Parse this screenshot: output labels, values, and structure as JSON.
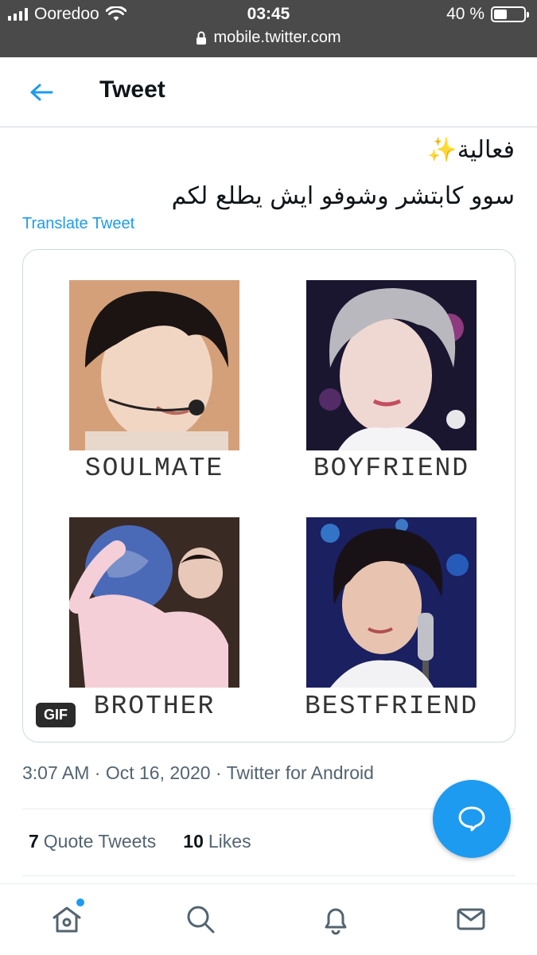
{
  "status_bar": {
    "carrier": "Ooredoo",
    "time": "03:45",
    "battery": "40 %",
    "url": "mobile.twitter.com"
  },
  "header": {
    "title": "Tweet",
    "back_icon": "arrow-left-icon"
  },
  "tweet": {
    "text_line1": "فعالية✨",
    "text_line2": "سوو كابتشر وشوفو ايش يطلع لكم",
    "translate_label": "Translate Tweet",
    "media": {
      "captions": [
        "SOULMATE",
        "BOYFRIEND",
        "BROTHER",
        "BESTFRIEND"
      ],
      "badge": "GIF"
    },
    "meta": {
      "time": "3:07 AM",
      "separator": "·",
      "date": "Oct 16, 2020",
      "source": "Twitter for Android"
    },
    "stats": {
      "quote_count": "7",
      "quote_label": "Quote Tweets",
      "like_count": "10",
      "like_label": "Likes"
    }
  },
  "fab_icon": "reply-bubble-icon",
  "bottom_nav": {
    "items": [
      "home-icon",
      "search-icon",
      "notifications-icon",
      "messages-icon"
    ]
  },
  "colors": {
    "accent": "#1d9bf0",
    "status_bar": "#4a4a4a",
    "secondary_text": "#536471"
  }
}
